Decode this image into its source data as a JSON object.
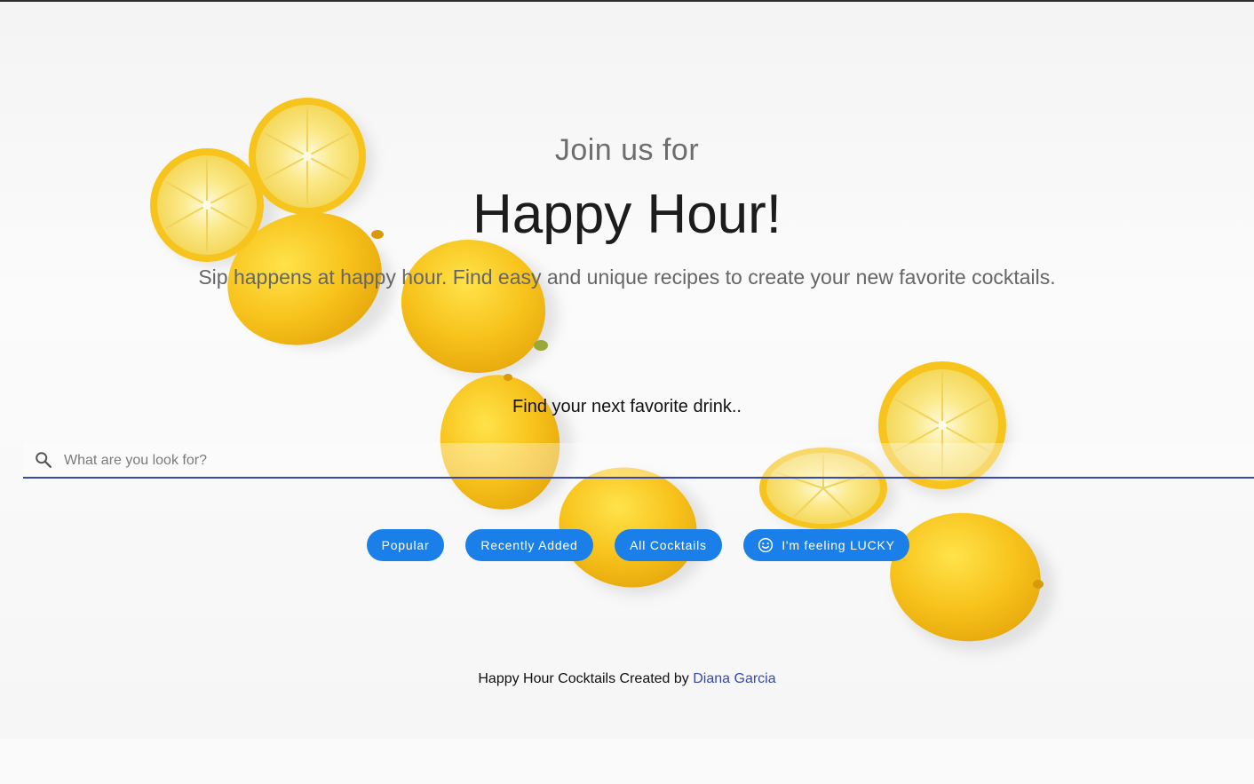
{
  "hero": {
    "pre_title": "Join us for",
    "title": "Happy Hour!",
    "subtitle": "Sip happens at happy hour. Find easy and unique recipes to create your new favorite cocktails."
  },
  "search": {
    "label": "Find your next favorite drink..",
    "placeholder": "What are you look for?",
    "value": "",
    "icon": "search-icon"
  },
  "filters": [
    {
      "label": "Popular"
    },
    {
      "label": "Recently Added"
    },
    {
      "label": "All Cocktails"
    },
    {
      "label": "I'm feeling LUCKY",
      "icon": "smile-icon"
    }
  ],
  "footer": {
    "text": "Happy Hour Cocktails Created by ",
    "author": "Diana Garcia"
  },
  "colors": {
    "accent": "#1a7fe8",
    "link": "#3949ab",
    "lemon": "#f6c928"
  }
}
